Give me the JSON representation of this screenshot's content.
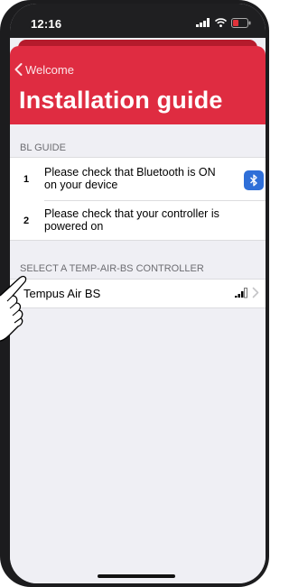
{
  "status_bar": {
    "time": "12:16",
    "icons": [
      "cellular-signal-icon",
      "wifi-icon",
      "battery-icon"
    ]
  },
  "nav": {
    "back_label": "Welcome",
    "title": "Installation guide",
    "accent_color": "#df2c41"
  },
  "guide": {
    "header": "BL GUIDE",
    "steps": [
      {
        "number": "1",
        "text": "Please check that Bluetooth is ON on your device",
        "icon": "bluetooth-icon"
      },
      {
        "number": "2",
        "text": "Please check that your controller is powered on"
      }
    ]
  },
  "controllers": {
    "header": "SELECT A TEMP-AIR-BS CONTROLLER",
    "items": [
      {
        "name": "Tempus Air BS",
        "icons": [
          "signal-strength-icon",
          "chevron-right-icon"
        ]
      }
    ]
  },
  "overlay": {
    "icon": "pointing-hand-icon"
  }
}
